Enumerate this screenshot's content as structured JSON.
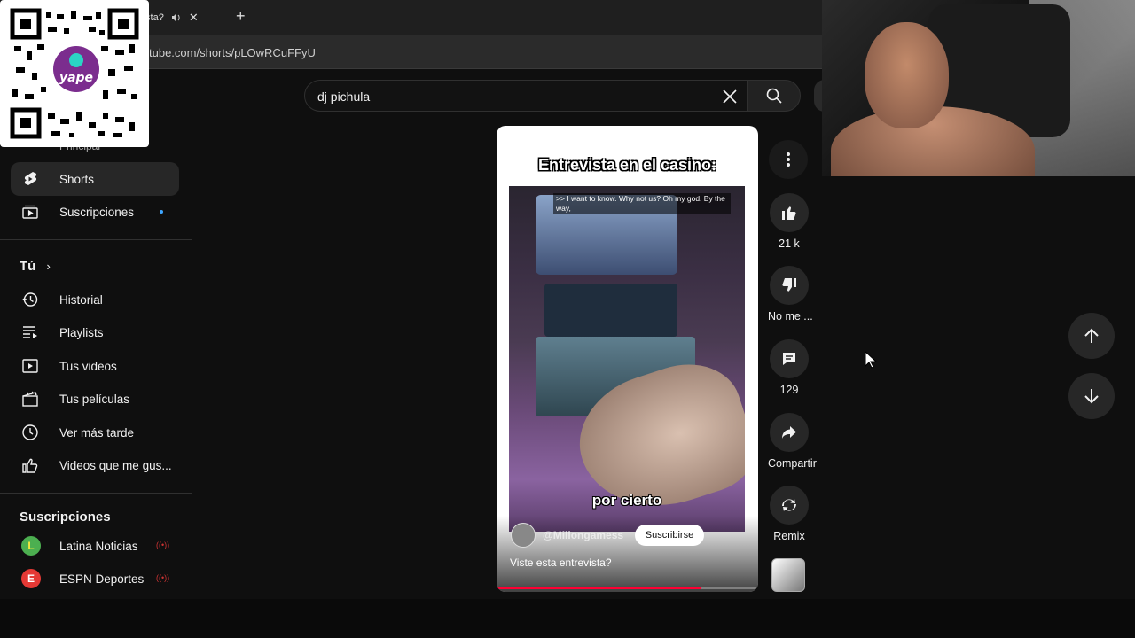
{
  "browser": {
    "tab_title": "evista?",
    "new_tab": "+",
    "url": "tube.com/shorts/pLOwRCuFFyU"
  },
  "search": {
    "query": "dj pichula"
  },
  "sidebar": {
    "partial_label": "Principal",
    "top_items": [
      {
        "label": "Shorts",
        "icon": "shorts-icon",
        "active": true
      },
      {
        "label": "Suscripciones",
        "icon": "subscriptions-icon"
      }
    ],
    "you_section_title": "Tú",
    "you_items": [
      {
        "label": "Historial",
        "icon": "history-icon"
      },
      {
        "label": "Playlists",
        "icon": "playlists-icon"
      },
      {
        "label": "Tus videos",
        "icon": "your-videos-icon"
      },
      {
        "label": "Tus películas",
        "icon": "movies-icon"
      },
      {
        "label": "Ver más tarde",
        "icon": "watch-later-icon"
      },
      {
        "label": "Videos que me gus...",
        "icon": "liked-videos-icon"
      }
    ],
    "subs_section_title": "Suscripciones",
    "subscriptions": [
      {
        "label": "Latina Noticias",
        "icon": "latina-avatar",
        "color": "#4caf50",
        "live": true
      },
      {
        "label": "ESPN Deportes",
        "icon": "espn-avatar",
        "color": "#e53935",
        "live": true
      }
    ]
  },
  "short": {
    "caption": "Entrevista en el casino:",
    "subtitle_lines": ">> I want to know. Why not us? Oh my god. By the way,",
    "burned_subtitle": "por cierto",
    "channel_handle": "@Millongamess",
    "subscribe_label": "Suscribirse",
    "title": "Viste esta entrevista?",
    "progress": 0.78
  },
  "actions": {
    "likes": "21 k",
    "dislike_label": "No me ...",
    "comments": "129",
    "share_label": "Compartir",
    "remix_label": "Remix"
  },
  "colors": {
    "background": "#0f0f0f",
    "accent": "#ff0033",
    "subscription_dot": "#3ea6ff"
  }
}
